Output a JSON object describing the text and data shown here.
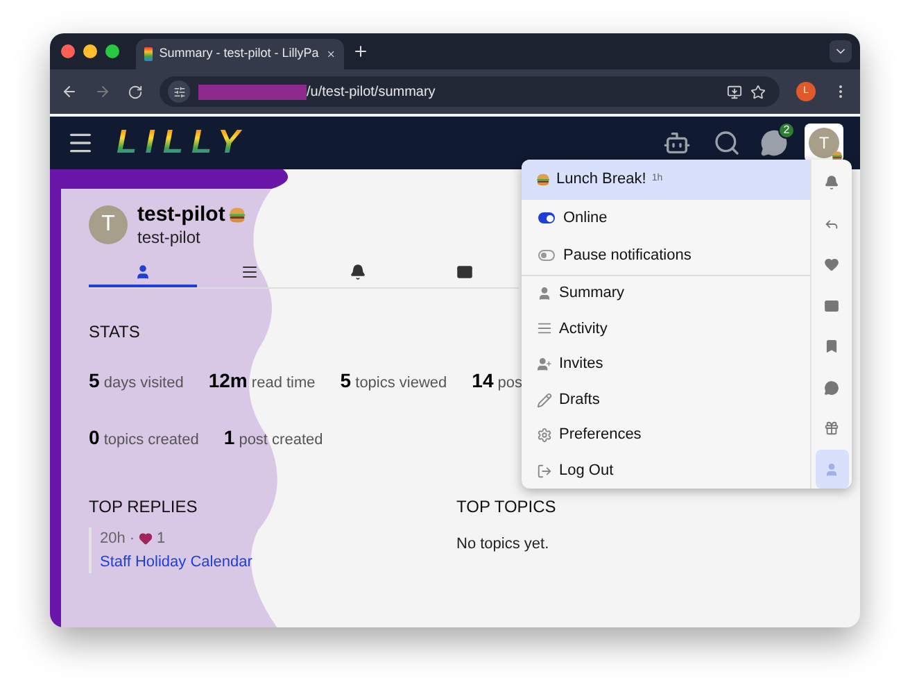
{
  "browser": {
    "tab_title": "Summary - test-pilot - LillyPa",
    "url_path": "/u/test-pilot/summary",
    "profile_initial": "L"
  },
  "header": {
    "logo": "LILLY",
    "chat_badge": "2",
    "avatar_initial": "T"
  },
  "profile": {
    "avatar_initial": "T",
    "name": "test-pilot",
    "username": "test-pilot"
  },
  "profile_tabs": [
    {
      "kind": "user",
      "selected": true
    },
    {
      "kind": "list",
      "selected": false
    },
    {
      "kind": "bell",
      "selected": false
    },
    {
      "kind": "mail",
      "selected": false
    }
  ],
  "stats": {
    "title": "STATS",
    "rows": [
      [
        "**5** days visited",
        "**12m** read time",
        "**5** topics viewed",
        "**14** pos"
      ],
      [
        "**0** topics created",
        "**1** post created"
      ]
    ]
  },
  "top_replies": {
    "title": "TOP REPLIES",
    "items": [
      {
        "age": "20h",
        "separator": "·",
        "likes": "1",
        "topic": "Staff Holiday Calendar"
      }
    ]
  },
  "top_topics": {
    "title": "TOP TOPICS",
    "empty": "No topics yet."
  },
  "user_menu": {
    "status": {
      "text": "Lunch Break!",
      "age": "1h"
    },
    "toggles": [
      {
        "label": "Online",
        "on": true
      },
      {
        "label": "Pause notifications",
        "on": false
      }
    ],
    "items": [
      {
        "kind": "user",
        "label": "Summary"
      },
      {
        "kind": "list",
        "label": "Activity"
      },
      {
        "kind": "invite",
        "label": "Invites"
      },
      {
        "kind": "pencil",
        "label": "Drafts"
      },
      {
        "kind": "gear",
        "label": "Preferences"
      },
      {
        "kind": "logout",
        "label": "Log Out"
      }
    ],
    "tabs": [
      {
        "kind": "bell",
        "selected": false
      },
      {
        "kind": "reply",
        "selected": false
      },
      {
        "kind": "heart",
        "selected": false
      },
      {
        "kind": "mail",
        "selected": false
      },
      {
        "kind": "bookmark",
        "selected": false
      },
      {
        "kind": "chat",
        "selected": false
      },
      {
        "kind": "gift",
        "selected": false
      },
      {
        "kind": "user",
        "selected": true
      }
    ]
  }
}
